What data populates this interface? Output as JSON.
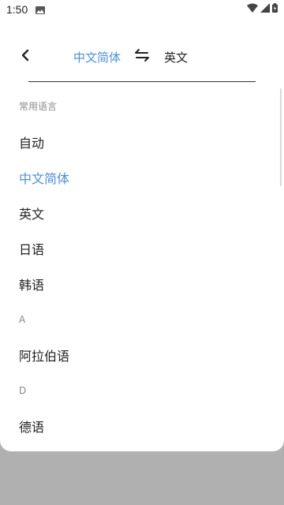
{
  "status_bar": {
    "time": "1:50"
  },
  "header": {
    "source_lang": "中文简体",
    "target_lang": "英文"
  },
  "colors": {
    "accent": "#4a90e2",
    "backdrop": "#b0b0b0"
  },
  "icons": {
    "back": "chevron-left-icon",
    "swap": "swap-arrows-icon",
    "status_image": "image-icon",
    "wifi": "wifi-icon",
    "signal": "signal-icon",
    "battery": "battery-icon"
  },
  "language_list": {
    "common_header": "常用语言",
    "common_items": [
      "自动",
      "中文简体",
      "英文",
      "日语",
      "韩语"
    ],
    "selected": "中文简体",
    "section_a": "A",
    "a_items": [
      "阿拉伯语"
    ],
    "section_d": "D",
    "d_items": [
      "德语"
    ]
  }
}
